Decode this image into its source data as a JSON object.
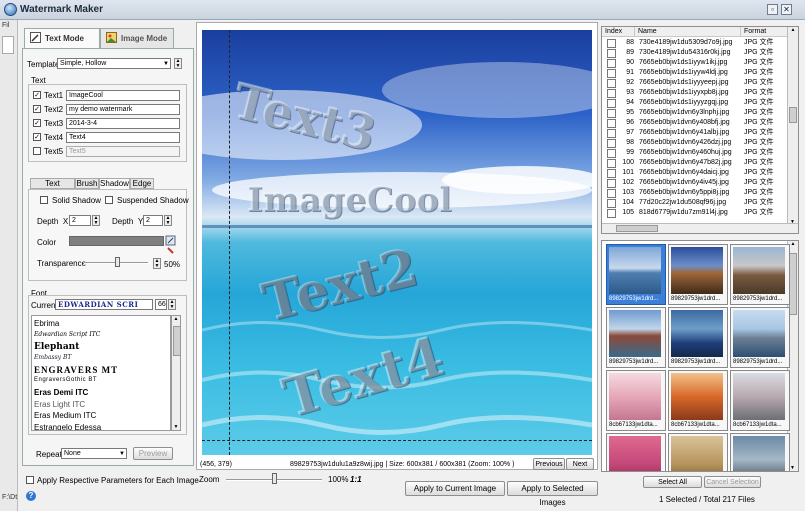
{
  "window": {
    "title": "Watermark Maker"
  },
  "strip": {
    "top_label": "Fil",
    "bottom_label": "F:\\Dt"
  },
  "tabs": {
    "text_mode": "Text Mode",
    "image_mode": "Image Mode"
  },
  "template": {
    "label": "Template",
    "value": "Simple, Hollow"
  },
  "text_group": {
    "title": "Text",
    "items": [
      {
        "label": "Text1",
        "value": "ImageCool",
        "checked": true
      },
      {
        "label": "Text2",
        "value": "my demo watermark",
        "checked": true
      },
      {
        "label": "Text3",
        "value": "2014-3-4",
        "checked": true
      },
      {
        "label": "Text4",
        "value": "Text4",
        "checked": true
      },
      {
        "label": "Text5",
        "value": "Text5",
        "checked": false
      }
    ]
  },
  "subtabs": [
    "Text Options",
    "Brush",
    "Shadow",
    "Edge"
  ],
  "shadow": {
    "solid": "Solid Shadow",
    "suspended": "Suspended Shadow",
    "depth_label": "Depth",
    "x_label": "X",
    "x_value": "2",
    "y_label": "Y",
    "y_value": "2",
    "color_label": "Color",
    "color": "#7f7f7f",
    "transparency_label": "Transparence",
    "transparency": "50%"
  },
  "font": {
    "title": "Font",
    "current_label": "Current",
    "current": "EDWARDIAN SCRI",
    "size": "66",
    "list": [
      "Ebrima",
      "Edwardian Script ITC",
      "Elephant",
      "Embassy BT",
      "ENGRAVERS MT",
      "EngraversGothic BT",
      "Eras Demi ITC",
      "Eras Light ITC",
      "Eras Medium ITC",
      "Estrangelo Edessa"
    ]
  },
  "repeat": {
    "label": "Repeat",
    "value": "None",
    "preview": "Preview"
  },
  "apply_each": "Apply Respective Parameters for Each Image",
  "canvas": {
    "watermarks": [
      "Text3",
      "ImageCool",
      "Text2",
      "Text4"
    ],
    "coords": "(456, 379)",
    "status": "89829753jw1dulu1a9z8wij.jpg  |  Size: 600x381 / 600x381  (Zoom: 100% )",
    "prev": "Previous",
    "next": "Next"
  },
  "zoom": {
    "label": "Zoom",
    "value": "100%",
    "one_to_one": "1:1",
    "fraction": 0.5
  },
  "buttons": {
    "apply_current": "Apply to Current Image",
    "apply_selected": "Apply to Selected Images",
    "select_all": "Select All",
    "cancel_selection": "Cancel Selection"
  },
  "table": {
    "headers": [
      "Index",
      "Name",
      "Format"
    ],
    "rows": [
      [
        "88",
        "730e4189jw1du5309d7o9j.jpg",
        "JPG 文件"
      ],
      [
        "89",
        "730e4189jw1du54316r0kj.jpg",
        "JPG 文件"
      ],
      [
        "90",
        "7665eb0bjw1ds1iyyw1ikj.jpg",
        "JPG 文件"
      ],
      [
        "91",
        "7665eb0bjw1ds1iyyw4ldj.jpg",
        "JPG 文件"
      ],
      [
        "92",
        "7665eb0bjw1ds1iyyyeepj.jpg",
        "JPG 文件"
      ],
      [
        "93",
        "7665eb0bjw1ds1iyyxpb8j.jpg",
        "JPG 文件"
      ],
      [
        "94",
        "7665eb0bjw1ds1iyyyzgqj.jpg",
        "JPG 文件"
      ],
      [
        "95",
        "7665eb0bjw1dvn6y3lnphj.jpg",
        "JPG 文件"
      ],
      [
        "96",
        "7665eb0bjw1dvn6y408bfj.jpg",
        "JPG 文件"
      ],
      [
        "97",
        "7665eb0bjw1dvn6y41albj.jpg",
        "JPG 文件"
      ],
      [
        "98",
        "7665eb0bjw1dvn6y426dzj.jpg",
        "JPG 文件"
      ],
      [
        "99",
        "7665eb0bjw1dvn6y460huj.jpg",
        "JPG 文件"
      ],
      [
        "100",
        "7665eb0bjw1dvn6y47b82j.jpg",
        "JPG 文件"
      ],
      [
        "101",
        "7665eb0bjw1dvn6y4daicj.jpg",
        "JPG 文件"
      ],
      [
        "102",
        "7665eb0bjw1dvn6y4iv45j.jpg",
        "JPG 文件"
      ],
      [
        "103",
        "7665eb0bjw1dvn6y5ppi8j.jpg",
        "JPG 文件"
      ],
      [
        "104",
        "77d20c22jw1du508qf96j.jpg",
        "JPG 文件"
      ],
      [
        "105",
        "818d6779jw1du7zm91l4j.jpg",
        "JPG 文件"
      ]
    ]
  },
  "thumbnails": [
    {
      "caption": "89829753jw1drd...",
      "selected": true
    },
    {
      "caption": "89829753jw1drd...",
      "selected": false
    },
    {
      "caption": "89829753jw1drd...",
      "selected": false
    },
    {
      "caption": "89829753jw1drd...",
      "selected": false
    },
    {
      "caption": "89829753jw1drd...",
      "selected": false
    },
    {
      "caption": "89829753jw1drd...",
      "selected": false
    },
    {
      "caption": "8cb67133jw1dta...",
      "selected": false
    },
    {
      "caption": "8cb67133jw1dta...",
      "selected": false
    },
    {
      "caption": "8cb67133jw1dta...",
      "selected": false
    },
    {
      "caption": "",
      "selected": false
    },
    {
      "caption": "",
      "selected": false
    },
    {
      "caption": "",
      "selected": false
    }
  ],
  "summary": "1 Selected / Total 217 Files"
}
